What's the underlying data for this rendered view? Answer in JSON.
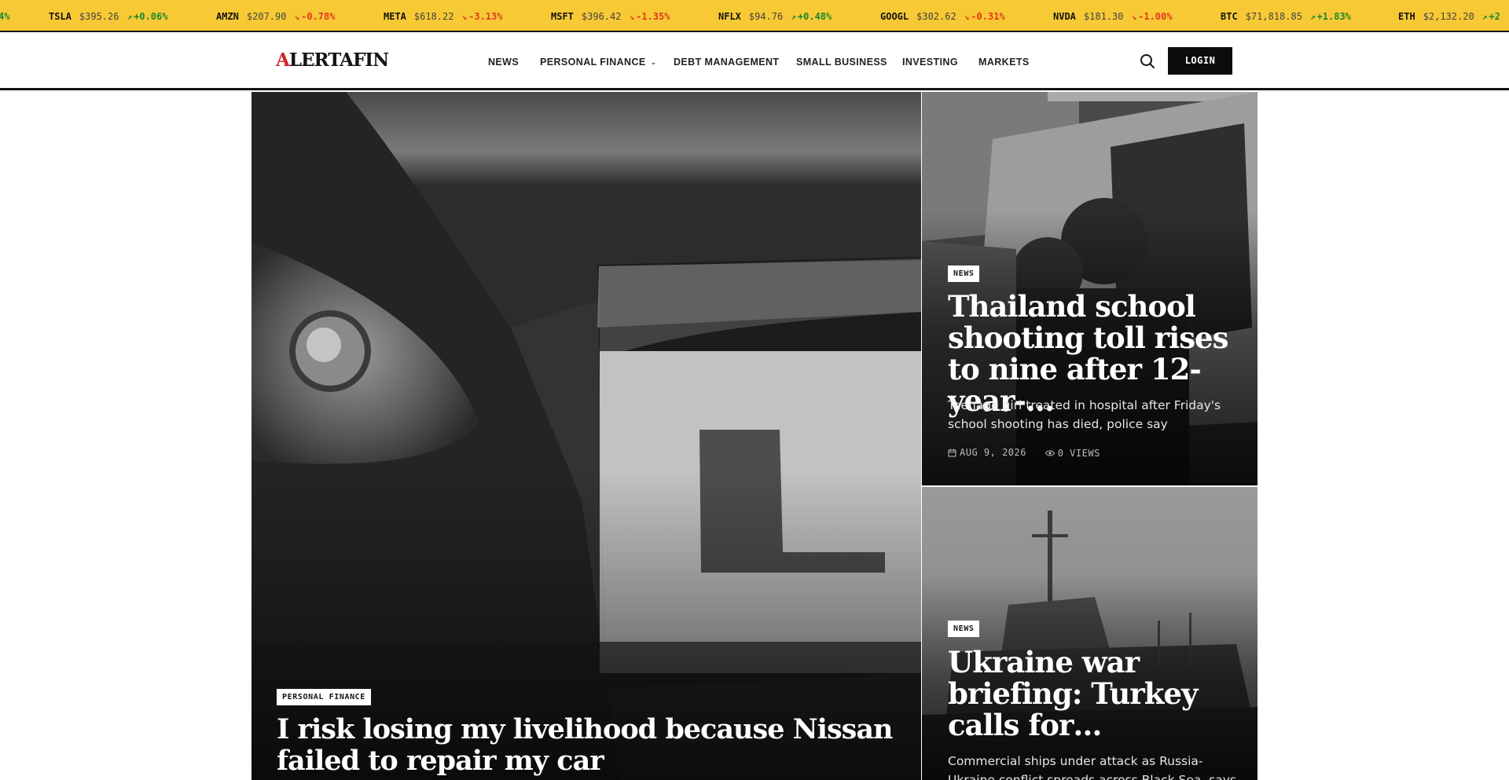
{
  "ticker": [
    {
      "symbol": "",
      "price": "",
      "change": "4%",
      "direction": "up"
    },
    {
      "symbol": "TSLA",
      "price": "$395.26",
      "change": "+0.06%",
      "direction": "up"
    },
    {
      "symbol": "AMZN",
      "price": "$207.90",
      "change": "-0.78%",
      "direction": "down"
    },
    {
      "symbol": "META",
      "price": "$618.22",
      "change": "-3.13%",
      "direction": "down"
    },
    {
      "symbol": "MSFT",
      "price": "$396.42",
      "change": "-1.35%",
      "direction": "down"
    },
    {
      "symbol": "NFLX",
      "price": "$94.76",
      "change": "+0.48%",
      "direction": "up"
    },
    {
      "symbol": "GOOGL",
      "price": "$302.62",
      "change": "-0.31%",
      "direction": "down"
    },
    {
      "symbol": "NVDA",
      "price": "$181.30",
      "change": "-1.00%",
      "direction": "down"
    },
    {
      "symbol": "BTC",
      "price": "$71,818.85",
      "change": "+1.83%",
      "direction": "up"
    },
    {
      "symbol": "ETH",
      "price": "$2,132.20",
      "change": "+2",
      "direction": "up"
    }
  ],
  "header": {
    "logo_first": "A",
    "logo_rest": "LERTAFIN",
    "nav": [
      {
        "label": "NEWS",
        "has_dropdown": false
      },
      {
        "label": "PERSONAL FINANCE",
        "has_dropdown": true
      },
      {
        "label": "DEBT MANAGEMENT",
        "has_dropdown": false
      },
      {
        "label": "SMALL BUSINESS",
        "has_dropdown": false
      },
      {
        "label": "INVESTING",
        "has_dropdown": false
      },
      {
        "label": "MARKETS",
        "has_dropdown": false
      }
    ],
    "search_icon": "search-icon",
    "login_label": "LOGIN"
  },
  "hero": {
    "main": {
      "category": "PERSONAL FINANCE",
      "headline": "I risk losing my livelihood because Nissan failed to repair my car"
    },
    "side": [
      {
        "category": "NEWS",
        "headline": "Thailand school shooting toll rises to nine after 12-year-…",
        "summary": "Teenage girl treated in hospital after Friday's school shooting has died, police say",
        "date": "AUG 9, 2026",
        "views": "0 VIEWS"
      },
      {
        "category": "NEWS",
        "headline": "Ukraine war briefing: Turkey calls for…",
        "summary": "Commercial ships under attack as Russia-Ukraine conflict spreads across Black Sea, says"
      }
    ]
  },
  "colors": {
    "ticker_bg": "#f7c934",
    "up": "#1b8a2e",
    "down": "#e03a1e",
    "logo_accent": "#d3242a",
    "login_bg": "#0c0c0c"
  }
}
